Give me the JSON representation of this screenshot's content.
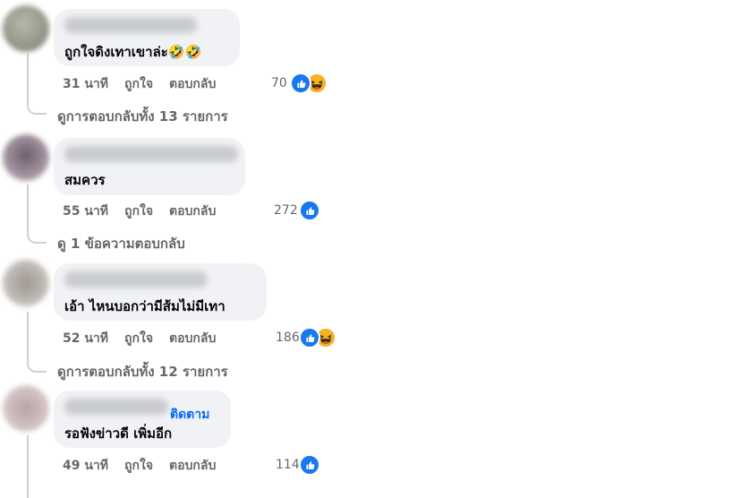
{
  "comments": [
    {
      "text": "ถูกใจดิงเทาเขาล่ะ🤣🤣",
      "time": "31 นาที",
      "like": "ถูกใจ",
      "reply": "ตอบกลับ",
      "reaction_count": "70",
      "reactions": [
        "like-icon",
        "haha-icon"
      ],
      "view_replies": "ดูการตอบกลับทั้ง 13 รายการ"
    },
    {
      "text": "สมควร",
      "time": "55 นาที",
      "like": "ถูกใจ",
      "reply": "ตอบกลับ",
      "reaction_count": "272",
      "reactions": [
        "like-icon"
      ],
      "view_replies": "ดู 1 ข้อความตอบกลับ"
    },
    {
      "text": "เอ้า ไหนบอกว่ามีส้มไม่มีเทา",
      "time": "52 นาที",
      "like": "ถูกใจ",
      "reply": "ตอบกลับ",
      "reaction_count": "186",
      "reactions": [
        "like-icon",
        "haha-icon"
      ],
      "view_replies": "ดูการตอบกลับทั้ง 12 รายการ"
    },
    {
      "follow": "ติดตาม",
      "text": "รอฟังข่าวดี เพิ่มอีก",
      "time": "49 นาที",
      "like": "ถูกใจ",
      "reply": "ตอบกลับ",
      "reaction_count": "114",
      "reactions": [
        "like-icon"
      ]
    }
  ],
  "colors": {
    "bubble": "#f0f2f5",
    "muted_text": "#65676b",
    "link_blue": "#0866ff",
    "like_blue": "#1877f2",
    "haha_yellow": "#f7b125"
  }
}
